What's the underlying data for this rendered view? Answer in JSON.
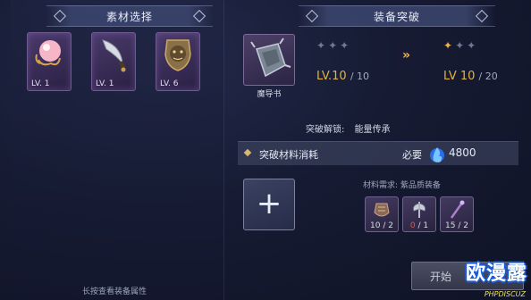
{
  "left_panel": {
    "title": "素材选择",
    "materials": [
      {
        "icon": "pink-orb-icon",
        "level": "LV. 1"
      },
      {
        "icon": "curved-dagger-icon",
        "level": "LV. 1"
      },
      {
        "icon": "beast-shield-icon",
        "level": "LV. 6"
      }
    ],
    "hint": "长按查看装备属性"
  },
  "right_panel": {
    "title": "装备突破",
    "equipment": {
      "icon": "spiked-gauntlet-icon",
      "name": "魔导书"
    },
    "current": {
      "stars_lit": 0,
      "stars_total": 3,
      "level": "LV.10",
      "max": "/ 10"
    },
    "arrow": "»",
    "next": {
      "stars_lit": 1,
      "stars_total": 3,
      "level": "LV 10",
      "max": "/ 20"
    },
    "unlock": {
      "label": "突破解锁:",
      "value": "能量传承"
    },
    "cost": {
      "label": "突破材料消耗",
      "required": "必要",
      "icon": "blue-energy-icon",
      "amount": "4800"
    },
    "add_button": "+",
    "requirements": {
      "title": "材料需求: 紫品质装备",
      "items": [
        {
          "icon": "purple-armor-icon",
          "have": "10",
          "need": "/ 2",
          "insufficient": false
        },
        {
          "icon": "purple-axe-icon",
          "have": "0",
          "need": "/ 1",
          "insufficient": true
        },
        {
          "icon": "purple-staff-icon",
          "have": "15",
          "need": "/ 2",
          "insufficient": false
        }
      ]
    },
    "start_button": "开始"
  },
  "watermark": {
    "main": "欧漫露",
    "sub": "PHPDISCUZ"
  },
  "colors": {
    "accent_gold": "#e7b23e",
    "insufficient_red": "#e0574b",
    "purple_frame": "#6f5a8f"
  }
}
